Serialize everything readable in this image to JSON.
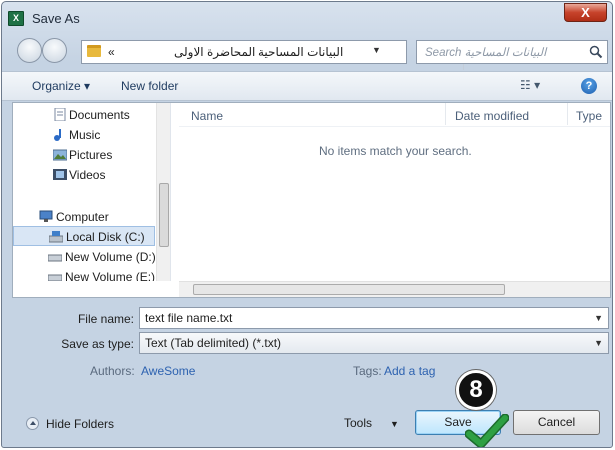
{
  "window": {
    "title": "Save As",
    "app_icon_text": "X",
    "close_label": "X"
  },
  "address": {
    "crumbs": [
      "البيانات المساحية",
      "المحاضرة الاولى",
      "»"
    ],
    "refresh_label": "↻"
  },
  "search": {
    "placeholder": "Search البيانات المساحية"
  },
  "toolbar": {
    "organize_label": "Organize ▾",
    "new_folder_label": "New folder",
    "view_label": "☷ ▾",
    "help_label": "?"
  },
  "nav_pane": {
    "items": [
      {
        "label": "Documents",
        "icon": "documents-icon"
      },
      {
        "label": "Music",
        "icon": "music-icon"
      },
      {
        "label": "Pictures",
        "icon": "pictures-icon"
      },
      {
        "label": "Videos",
        "icon": "videos-icon"
      },
      {
        "label": "Computer",
        "icon": "computer-icon"
      },
      {
        "label": "Local Disk (C:)",
        "icon": "drive-icon",
        "selected": true
      },
      {
        "label": "New Volume (D:)",
        "icon": "drive-icon"
      },
      {
        "label": "New Volume (E:)",
        "icon": "drive-icon"
      }
    ]
  },
  "file_list": {
    "columns": [
      "Name",
      "Date modified",
      "Type"
    ],
    "empty_message": "No items match your search."
  },
  "form": {
    "file_name_label": "File name:",
    "file_name_value": "text file name.txt",
    "save_type_label": "Save as type:",
    "save_type_value": "Text (Tab delimited) (*.txt)",
    "authors_label": "Authors:",
    "authors_value": "AweSome",
    "tags_label": "Tags:",
    "tags_value": "Add a tag"
  },
  "footer": {
    "hide_folders_label": "Hide Folders",
    "tools_label": "Tools",
    "save_label": "Save",
    "cancel_label": "Cancel"
  },
  "annotation": {
    "step_number": "8"
  },
  "colors": {
    "accent_blue": "#3c7fb1",
    "check_green": "#2ea043",
    "close_red": "#c7432b"
  }
}
